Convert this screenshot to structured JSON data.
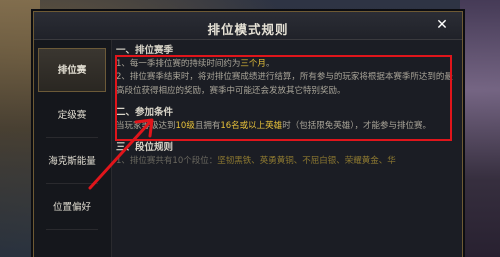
{
  "dialog": {
    "title": "排位模式规则",
    "close_icon": "close-icon"
  },
  "sidebar": {
    "items": [
      {
        "label": "排位赛",
        "active": true
      },
      {
        "label": "定级赛",
        "active": false
      },
      {
        "label": "海克斯能量",
        "active": false
      },
      {
        "label": "位置偏好",
        "active": false
      }
    ]
  },
  "content": {
    "section1": {
      "title": "一、排位赛季",
      "line1_pre": "1、每一季排位赛的持续时间约为",
      "line1_hl": "三个月",
      "line1_post": "。",
      "line2": "2、排位赛季结束时，将对排位赛成绩进行结算，所有参与的玩家将根据本赛季所达到的最高段位获得相应的奖励，赛季中可能还会发放其它特别奖励。"
    },
    "section2": {
      "title": "二、参加条件",
      "text_pre": "当玩家等级达到",
      "hl1": "10级",
      "text_mid": "且拥有",
      "hl2": "16名或以上英雄",
      "text_post": "时（包括限免英雄），才能参与排位赛。"
    },
    "section3": {
      "title": "三、段位规则",
      "line1_pre": "1、排位赛共有10个段位：",
      "line1_hl": "坚韧黑铁、英勇黄铜、不屈白银、荣耀黄金、华"
    }
  },
  "colors": {
    "accent": "#e8c23a",
    "annotation": "#e0151b",
    "frame": "#6e5a34"
  }
}
